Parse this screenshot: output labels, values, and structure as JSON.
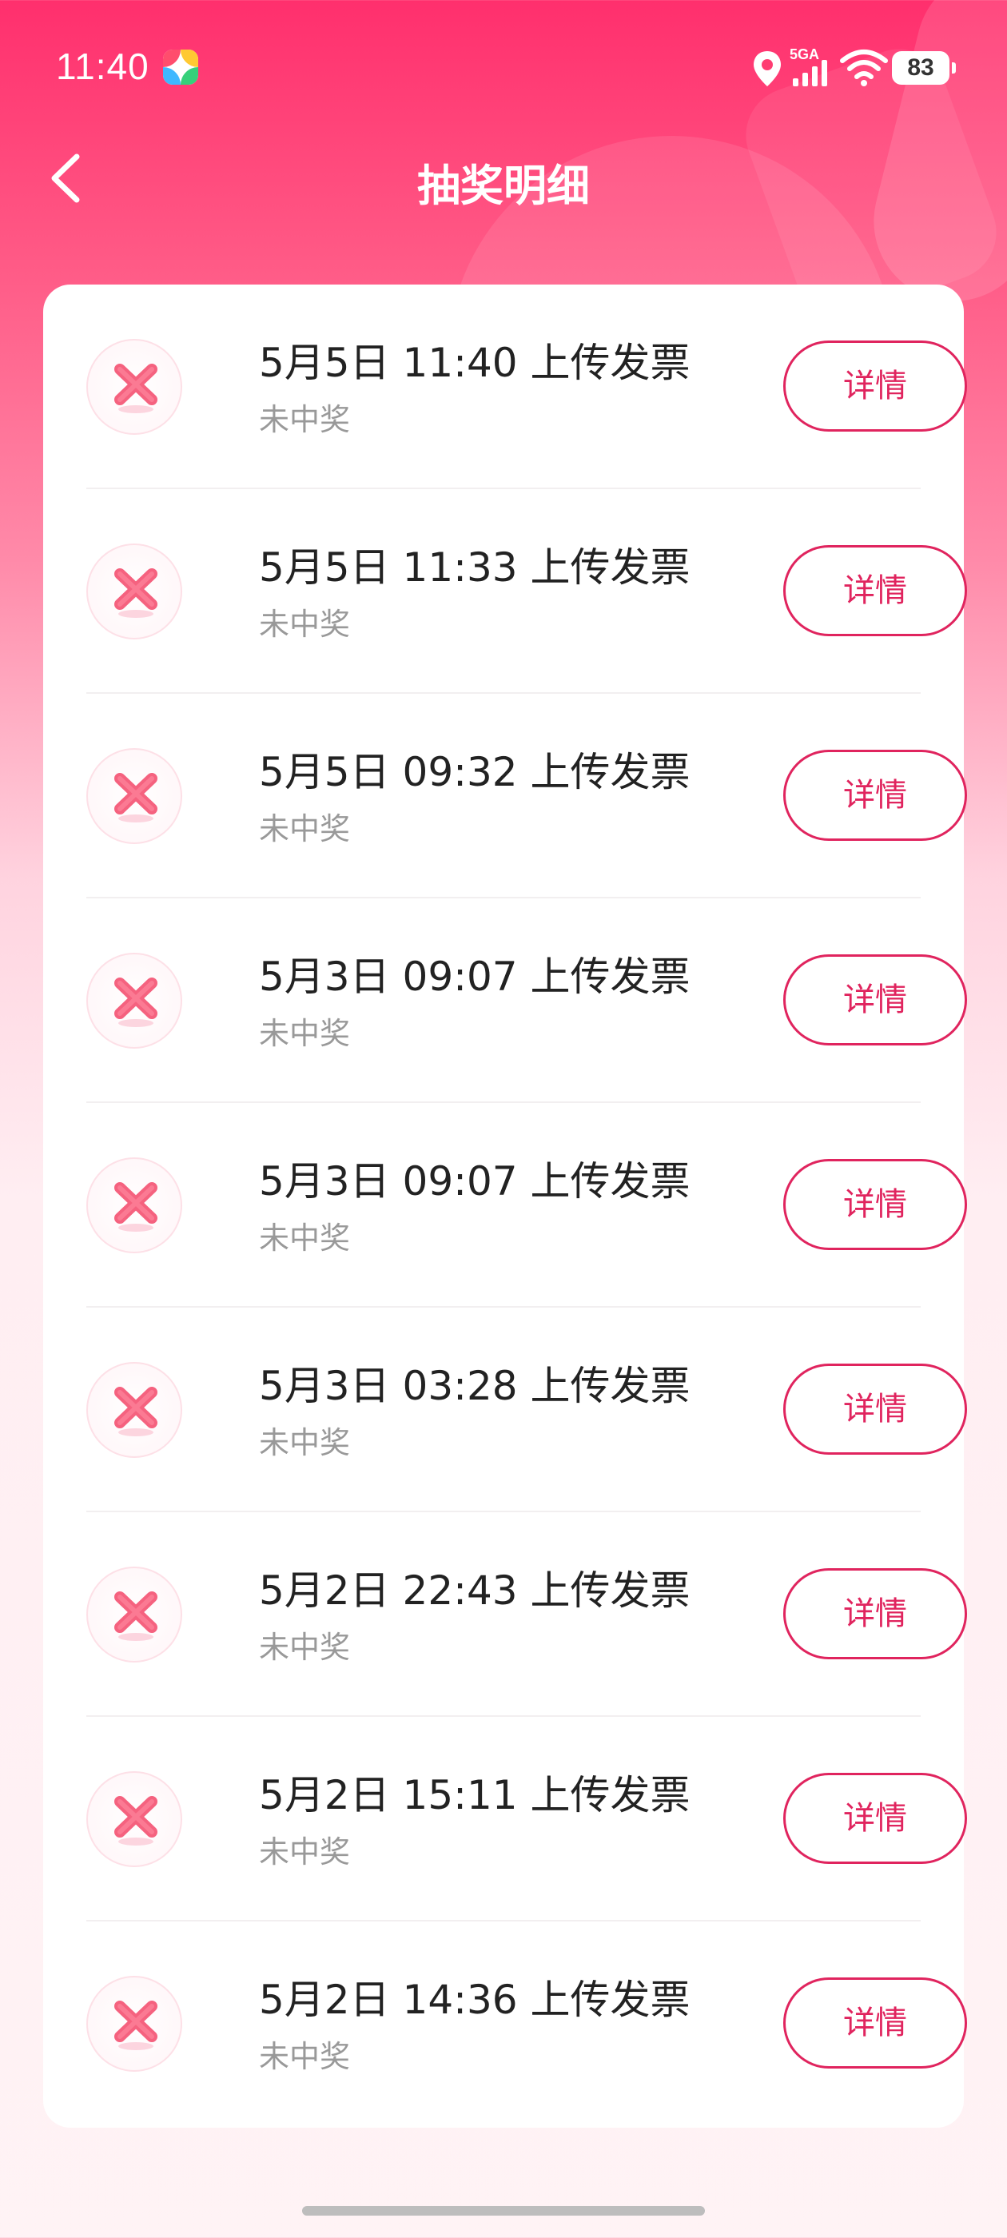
{
  "status_bar": {
    "time": "11:40",
    "network": "5GA",
    "battery": "83",
    "icons": [
      "app-icon",
      "location-icon",
      "signal-icon",
      "wifi-icon",
      "battery-icon"
    ]
  },
  "nav": {
    "back_icon": "chevron-left-icon",
    "title": "抽奖明细"
  },
  "colors": {
    "accent": "#e0245e",
    "header_gradient_top": "#ff2f6d",
    "title_text": "#222222",
    "status_text": "#999999"
  },
  "records": [
    {
      "title": "5月5日 11:40 上传发票",
      "status": "未中奖",
      "button": "详情",
      "icon": "not-won-x-icon"
    },
    {
      "title": "5月5日 11:33 上传发票",
      "status": "未中奖",
      "button": "详情",
      "icon": "not-won-x-icon"
    },
    {
      "title": "5月5日 09:32 上传发票",
      "status": "未中奖",
      "button": "详情",
      "icon": "not-won-x-icon"
    },
    {
      "title": "5月3日 09:07 上传发票",
      "status": "未中奖",
      "button": "详情",
      "icon": "not-won-x-icon"
    },
    {
      "title": "5月3日 09:07 上传发票",
      "status": "未中奖",
      "button": "详情",
      "icon": "not-won-x-icon"
    },
    {
      "title": "5月3日 03:28 上传发票",
      "status": "未中奖",
      "button": "详情",
      "icon": "not-won-x-icon"
    },
    {
      "title": "5月2日 22:43 上传发票",
      "status": "未中奖",
      "button": "详情",
      "icon": "not-won-x-icon"
    },
    {
      "title": "5月2日 15:11 上传发票",
      "status": "未中奖",
      "button": "详情",
      "icon": "not-won-x-icon"
    },
    {
      "title": "5月2日 14:36 上传发票",
      "status": "未中奖",
      "button": "详情",
      "icon": "not-won-x-icon"
    }
  ]
}
